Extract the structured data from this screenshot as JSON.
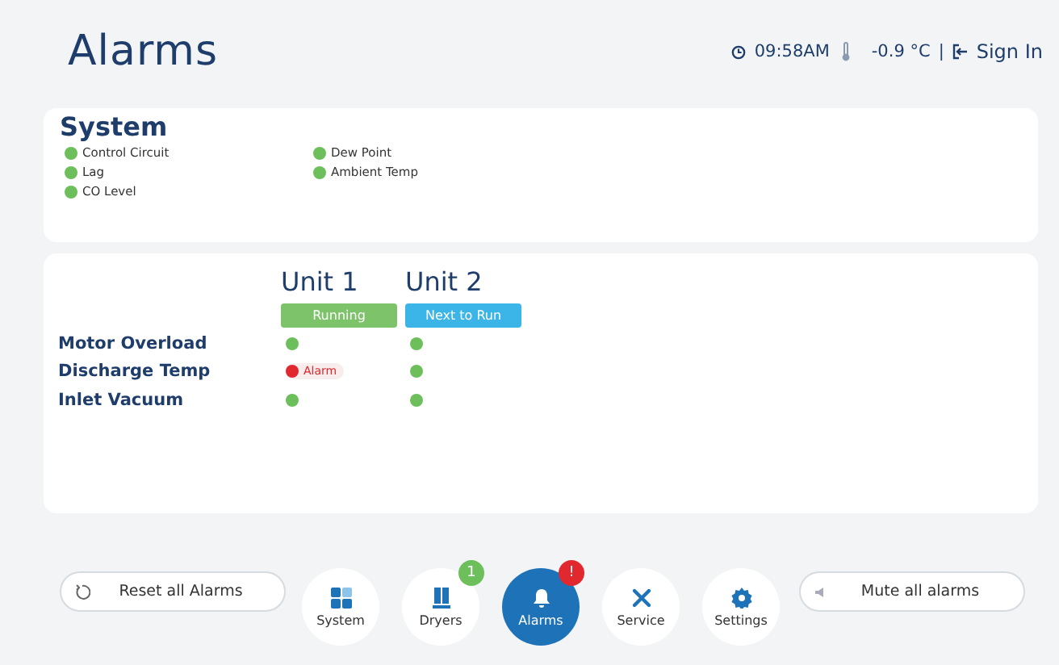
{
  "header": {
    "title": "Alarms",
    "time": "09:58AM",
    "temperature": "-0.9 °C",
    "separator": "|",
    "sign_in": "Sign In"
  },
  "system": {
    "title": "System",
    "items": [
      {
        "label": "Control Circuit",
        "alarm": false
      },
      {
        "label": "Dew Point",
        "alarm": false
      },
      {
        "label": "Lag",
        "alarm": false
      },
      {
        "label": "Ambient Temp",
        "alarm": false
      },
      {
        "label": "CO Level",
        "alarm": false
      }
    ]
  },
  "units": {
    "columns": [
      {
        "name": "Unit 1",
        "state": "Running",
        "color": "#7cc36a"
      },
      {
        "name": "Unit 2",
        "state": "Next to Run",
        "color": "#3bb5e8"
      }
    ],
    "rows": [
      {
        "label": "Motor Overload",
        "cells": [
          {
            "alarm": false
          },
          {
            "alarm": false
          }
        ]
      },
      {
        "label": "Discharge Temp",
        "cells": [
          {
            "alarm": true,
            "text": "Alarm"
          },
          {
            "alarm": false
          }
        ]
      },
      {
        "label": "Inlet Vacuum",
        "cells": [
          {
            "alarm": false
          },
          {
            "alarm": false
          }
        ]
      }
    ]
  },
  "reset_button": "Reset all Alarms",
  "nav": [
    {
      "kind": "system",
      "label": "System",
      "selected": false
    },
    {
      "kind": "dryers",
      "label": "Dryers",
      "selected": false,
      "badge": {
        "text": "1",
        "color": "#6cbf5a"
      }
    },
    {
      "kind": "alarms",
      "label": "Alarms",
      "selected": true,
      "badge": {
        "text": "!",
        "color": "#e0282e"
      }
    },
    {
      "kind": "service",
      "label": "Service",
      "selected": false
    },
    {
      "kind": "settings",
      "label": "Settings",
      "selected": false
    }
  ],
  "mute_button": "Mute all alarms"
}
